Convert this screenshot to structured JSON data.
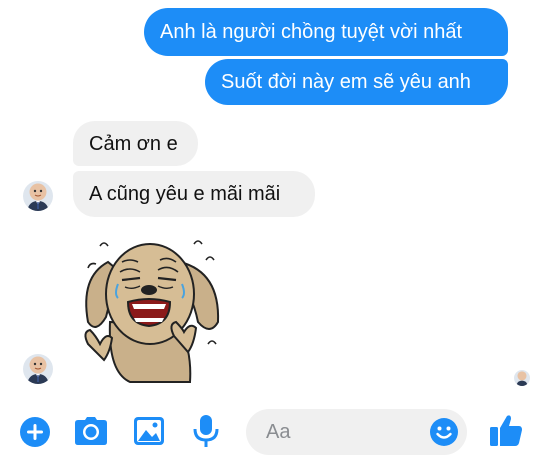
{
  "conversation": {
    "messages": [
      {
        "direction": "outgoing",
        "text": "Anh là người chồng tuyệt vời nhất"
      },
      {
        "direction": "outgoing",
        "text": "Suốt đời này em sẽ yêu anh"
      },
      {
        "direction": "incoming",
        "text": "Cảm ơn e"
      },
      {
        "direction": "incoming",
        "text": "A cũng yêu e mãi mãi"
      }
    ],
    "sticker": {
      "description": "crying-dog-sticker"
    }
  },
  "composer": {
    "placeholder": "Aa",
    "icons": [
      "plus-icon",
      "camera-icon",
      "image-icon",
      "mic-icon",
      "emoji-icon",
      "like-icon"
    ]
  },
  "colors": {
    "accent": "#1d8df7",
    "incoming_bubble": "#f0f0f0",
    "outgoing_text": "#ffffff",
    "incoming_text": "#111111"
  }
}
